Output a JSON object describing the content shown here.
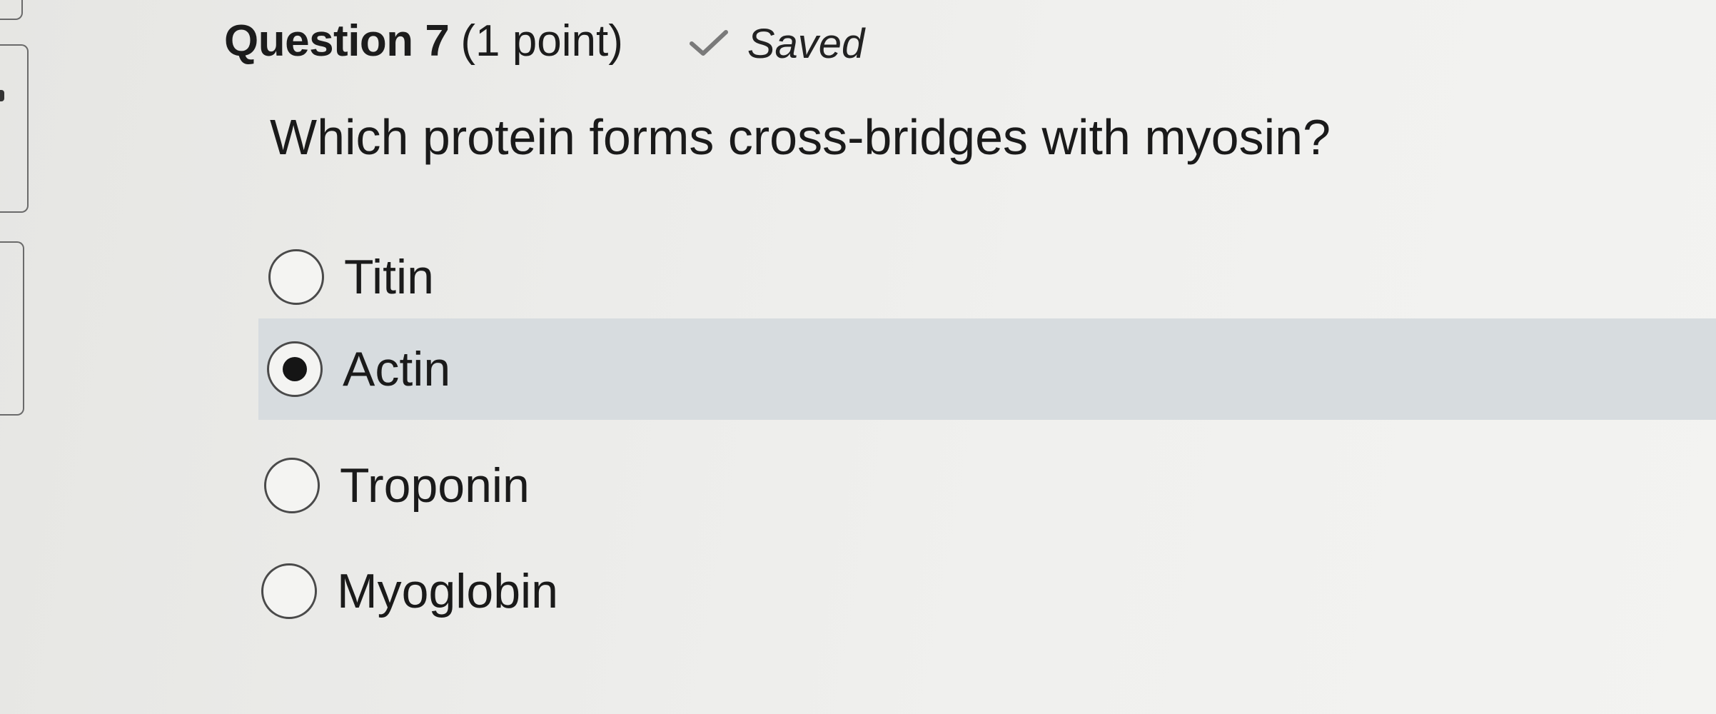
{
  "question": {
    "title": "Question 7",
    "points": "(1 point)",
    "status": "Saved",
    "prompt": "Which protein forms cross-bridges with myosin?"
  },
  "options": [
    {
      "label": "Titin",
      "selected": false
    },
    {
      "label": "Actin",
      "selected": true
    },
    {
      "label": "Troponin",
      "selected": false
    },
    {
      "label": "Myoglobin",
      "selected": false
    }
  ]
}
